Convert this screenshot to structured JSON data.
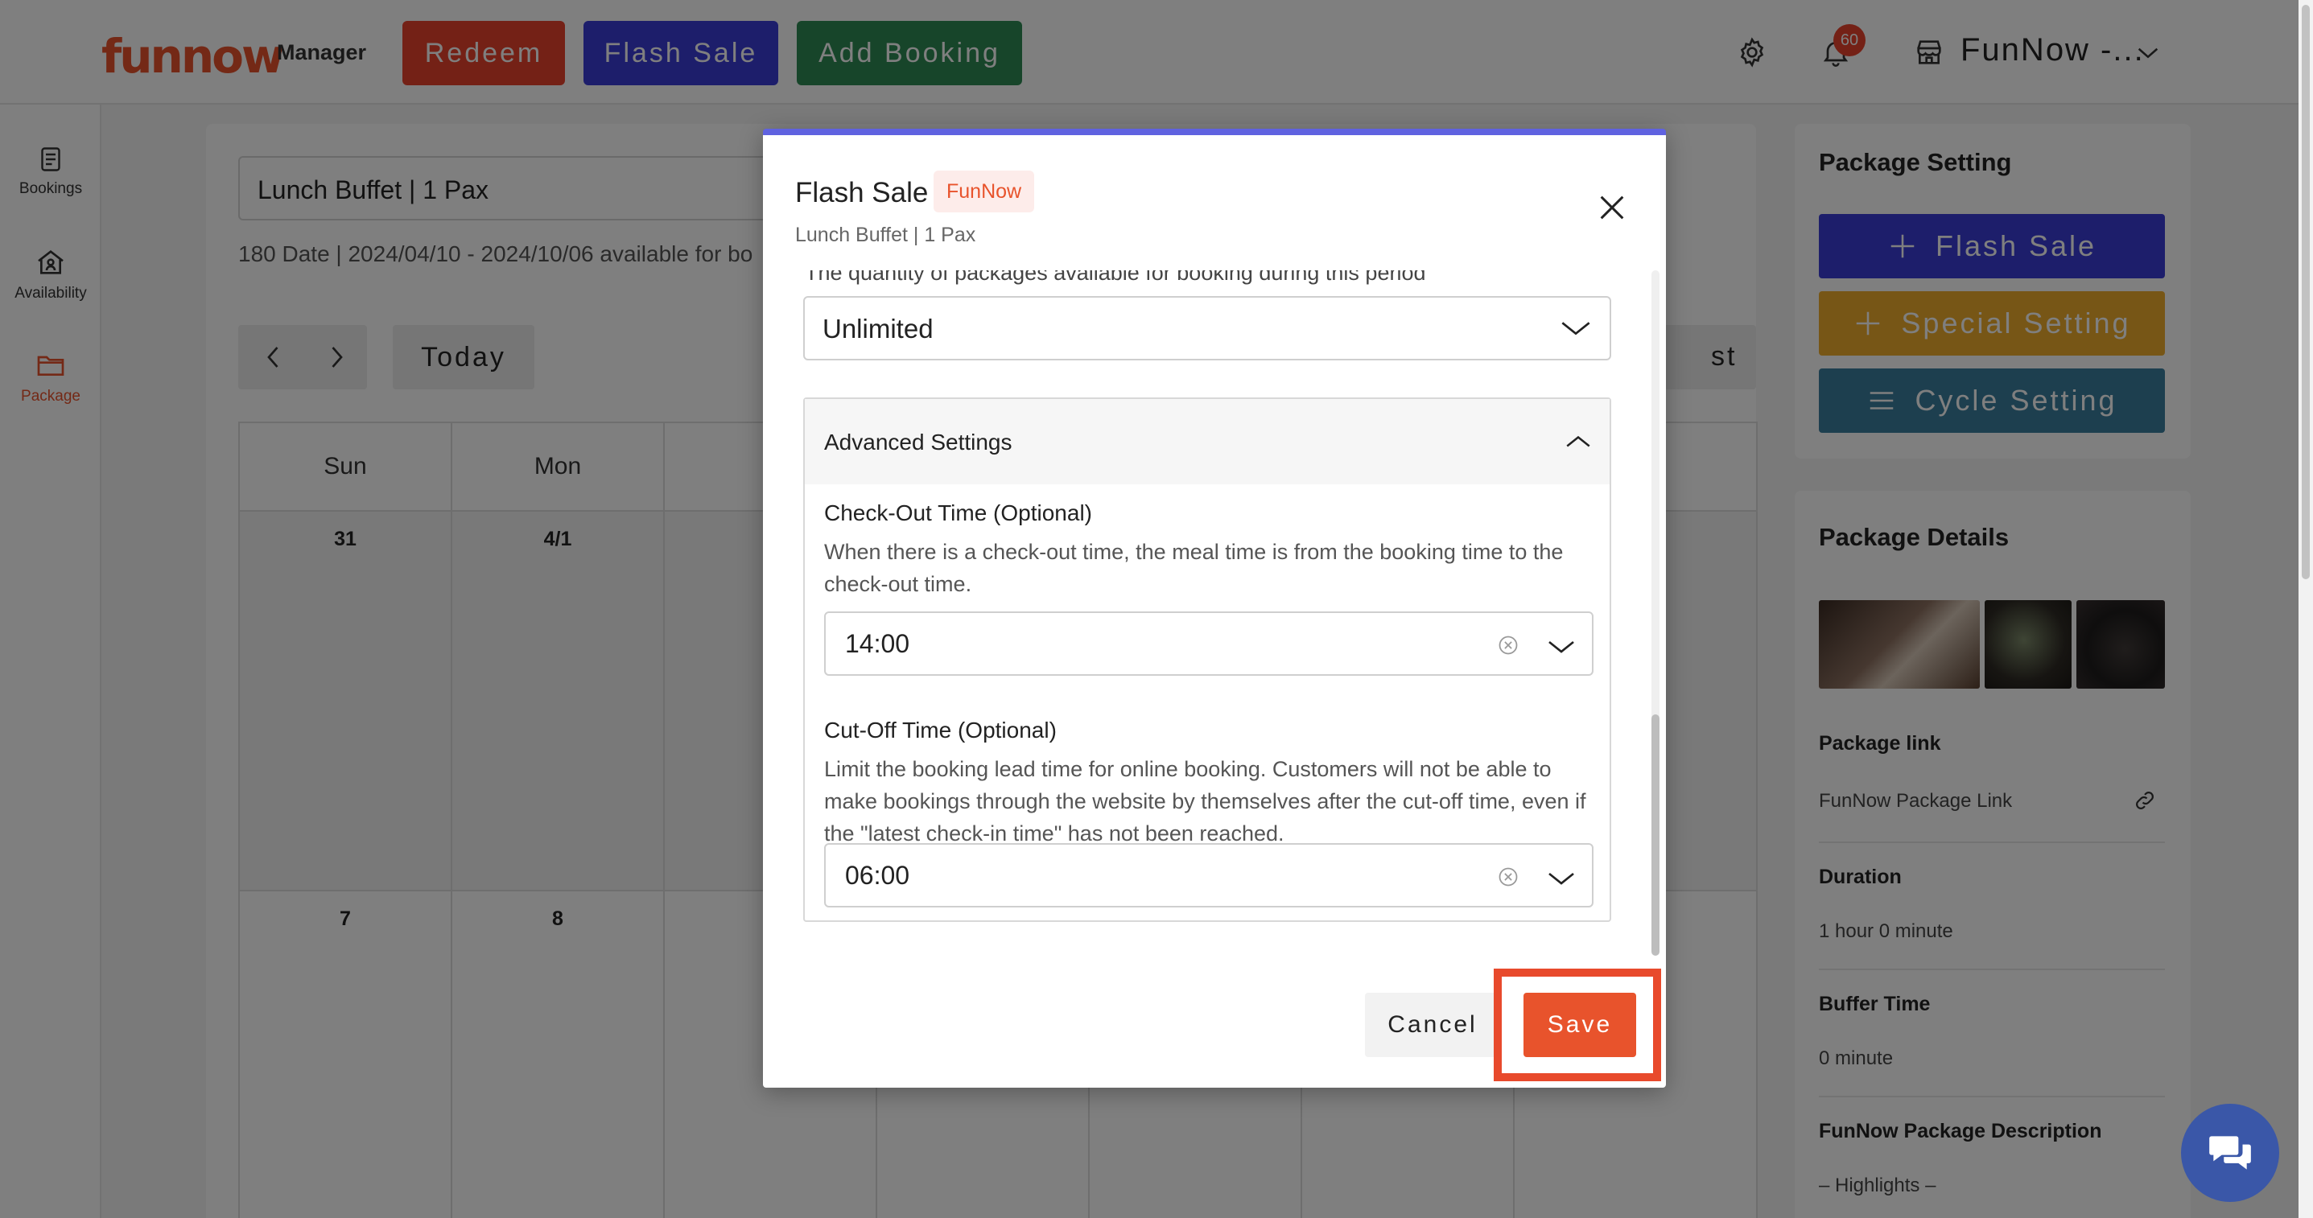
{
  "topbar": {
    "logo": "funnow",
    "logo_sub": "Manager",
    "redeem_label": "Redeem",
    "flash_sale_label": "Flash Sale",
    "add_booking_label": "Add Booking",
    "notif_count": "60",
    "shop_name": "FunNow -...",
    "icons": [
      "gear-icon",
      "bell-icon",
      "store-icon",
      "chevron-down-icon"
    ]
  },
  "sidenav": {
    "items": [
      {
        "label": "Bookings",
        "icon": "document-icon"
      },
      {
        "label": "Availability",
        "icon": "home-user-icon"
      },
      {
        "label": "Package",
        "icon": "folder-icon",
        "active": true
      }
    ]
  },
  "main": {
    "package_select": "Lunch Buffet | 1 Pax",
    "date_line": "180 Date | 2024/04/10 - 2024/10/06 available for bo",
    "today_label": "Today",
    "list_label_partial": "st",
    "days": [
      "Sun",
      "Mon",
      "T"
    ],
    "row1_dates": [
      "31",
      "4/1"
    ],
    "row2_dates": [
      "7",
      "8"
    ]
  },
  "right": {
    "package_setting_title": "Package Setting",
    "flash_sale_btn": "Flash Sale",
    "special_setting_btn": "Special Setting",
    "cycle_setting_btn": "Cycle Setting",
    "package_details_title": "Package Details",
    "package_link_label": "Package link",
    "package_link_value": "FunNow Package Link",
    "duration_label": "Duration",
    "duration_value": "1 hour 0 minute",
    "buffer_label": "Buffer Time",
    "buffer_value": "0 minute",
    "desc_label": "FunNow Package Description",
    "desc_value": "– Highlights –"
  },
  "modal": {
    "title": "Flash Sale",
    "tag": "FunNow",
    "subtitle": "Lunch Buffet | 1 Pax",
    "qty_help": "The quantity of packages available for booking during this period",
    "qty_value": "Unlimited",
    "advanced_title": "Advanced Settings",
    "checkout_label": "Check-Out Time (Optional)",
    "checkout_help": "When there is a check-out time, the meal time is from the booking time to the check-out time.",
    "checkout_value": "14:00",
    "cutoff_label": "Cut-Off Time (Optional)",
    "cutoff_help": "Limit the booking lead time for online booking. Customers will not be able to make bookings through the website by themselves after the cut-off time, even if the \"latest check-in time\" has not been reached.",
    "cutoff_value": "06:00",
    "cancel_label": "Cancel",
    "save_label": "Save"
  },
  "colors": {
    "brand": "#e8532c",
    "flash": "#3b3dd6",
    "add_booking": "#2f8a55",
    "special": "#efac2c",
    "cycle": "#3a7e9e",
    "modal_accent": "#5f62e0"
  }
}
